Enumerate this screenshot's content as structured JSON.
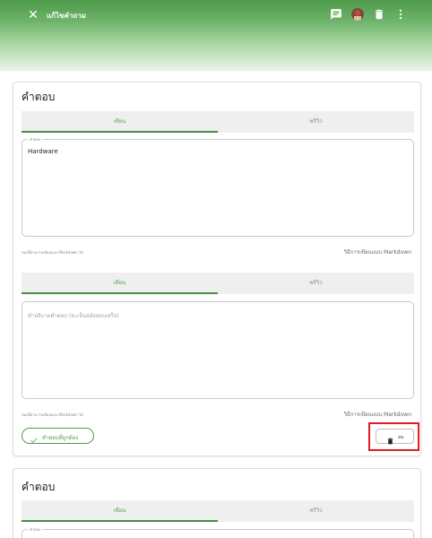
{
  "header": {
    "title": "แก้ไขคำถาม",
    "icons": [
      "close-icon",
      "comment-icon",
      "avatar",
      "trash-icon",
      "more-vert-icon"
    ],
    "colors": {
      "gradient_top": "#4e9a4a",
      "accent": "#4f9f4c",
      "highlight": "#e01b24"
    }
  },
  "card1": {
    "title": "คำตอบ",
    "answer_tabs": {
      "write": "เขียน",
      "preview": "พรีวิว"
    },
    "answer_field": {
      "label": "คำตอบ",
      "value": "Hardware"
    },
    "answer_hint": "ช่องนี้สามารถเขียนแบบ Markdown ได้",
    "answer_md_link": "วิธีการเขียนแบบ Markdown",
    "explain_tabs": {
      "write": "เขียน",
      "preview": "พรีวิว"
    },
    "explain_field": {
      "placeholder": "คำอธิบายคำตอบ (จะเห็นหลังสอบเสร็จ)"
    },
    "explain_hint": "ช่องนี้สามารถเขียนแบบ Markdown ได้",
    "explain_md_link": "วิธีการเขียนแบบ Markdown",
    "correct_button": "คำตอบที่ถูกต้อง",
    "delete_button": "ลบ"
  },
  "card2": {
    "title": "คำตอบ",
    "answer_tabs": {
      "write": "เขียน",
      "preview": "พรีวิว"
    },
    "answer_field": {
      "label": "คำตอบ"
    }
  }
}
